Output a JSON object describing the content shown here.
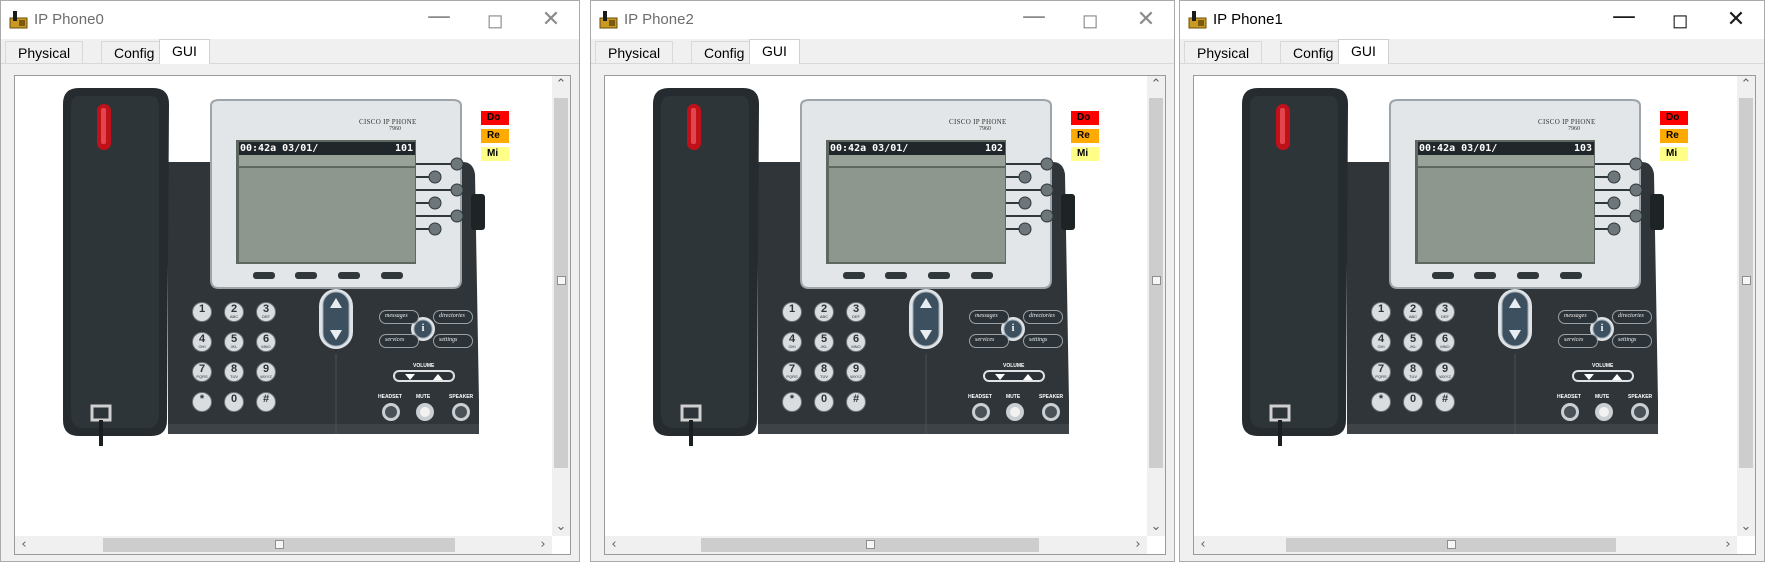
{
  "colors": {
    "chassis": "#2f3539",
    "chassis_dark": "#1e2326",
    "handset": "#252b2e",
    "faceplate": "#e3e6e8",
    "lcd": "#8d978d",
    "lcd_bar": "#20262a",
    "do_indicator": "#ff0000",
    "re_indicator": "#ffaa00",
    "mi_indicator": "#ffff88",
    "hook_led": "#c0111a"
  },
  "icons": {
    "app": "ip-phone-icon",
    "minimize": "minimize-icon",
    "maximize": "maximize-icon",
    "close": "close-icon"
  },
  "windows": [
    {
      "title": "IP Phone0",
      "tabs": [
        "Physical",
        "Config",
        "GUI"
      ],
      "active_tab": "GUI",
      "brand": "CISCO IP PHONE",
      "model": "7960",
      "lcd": {
        "time": "00:42a 03/01/",
        "extension": "101"
      },
      "indicators": [
        "Do",
        "Re",
        "Mi"
      ]
    },
    {
      "title": "IP Phone2",
      "tabs": [
        "Physical",
        "Config",
        "GUI"
      ],
      "active_tab": "GUI",
      "brand": "CISCO IP PHONE",
      "model": "7960",
      "lcd": {
        "time": "00:42a 03/01/",
        "extension": "102"
      },
      "indicators": [
        "Do",
        "Re",
        "Mi"
      ]
    },
    {
      "title": "IP Phone1",
      "tabs": [
        "Physical",
        "Config",
        "GUI"
      ],
      "active_tab": "GUI",
      "brand": "CISCO IP PHONE",
      "model": "7960",
      "lcd": {
        "time": "00:42a 03/01/",
        "extension": "103"
      },
      "indicators": [
        "Do",
        "Re",
        "Mi"
      ]
    }
  ],
  "keypad": [
    {
      "digit": "1",
      "letters": ""
    },
    {
      "digit": "2",
      "letters": "ABC"
    },
    {
      "digit": "3",
      "letters": "DEF"
    },
    {
      "digit": "4",
      "letters": "GHI"
    },
    {
      "digit": "5",
      "letters": "JKL"
    },
    {
      "digit": "6",
      "letters": "MNO"
    },
    {
      "digit": "7",
      "letters": "PQRS"
    },
    {
      "digit": "8",
      "letters": "TUV"
    },
    {
      "digit": "9",
      "letters": "WXYZ"
    },
    {
      "digit": "*",
      "letters": ""
    },
    {
      "digit": "0",
      "letters": ""
    },
    {
      "digit": "#",
      "letters": ""
    }
  ],
  "feature_buttons": {
    "messages": "messages",
    "directories": "directories",
    "services": "services",
    "settings": "settings",
    "info": "i"
  },
  "volume_label": "VOLUME",
  "bottom_labels": {
    "headset": "HEADSET",
    "mute": "MUTE",
    "speaker": "SPEAKER"
  }
}
